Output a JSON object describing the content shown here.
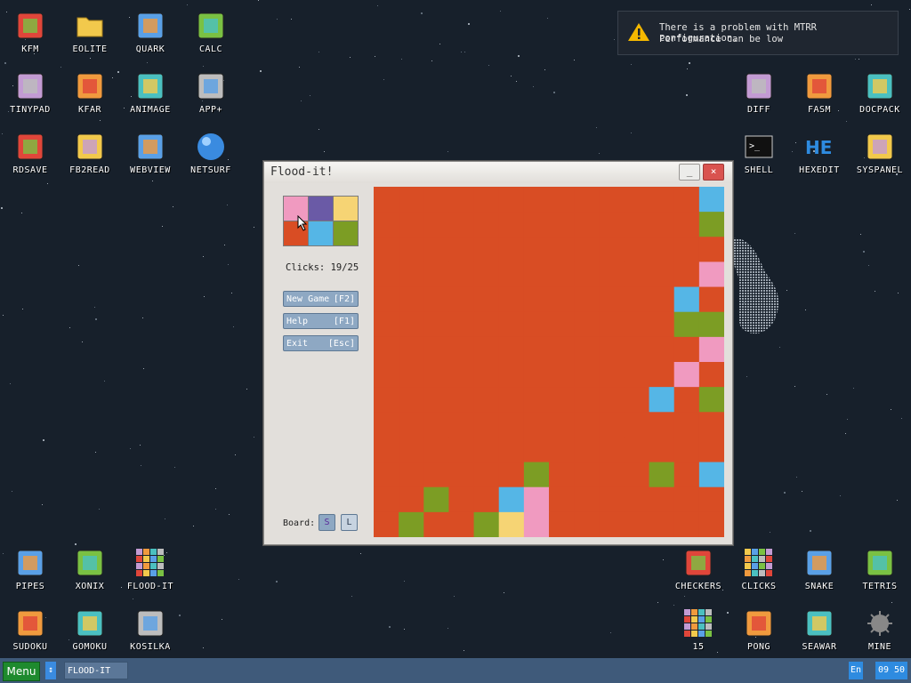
{
  "desktop_icons": [
    {
      "label": "KFM",
      "icon": "floppy-disk-icon"
    },
    {
      "label": "EOLITE",
      "icon": "folder-icon"
    },
    {
      "label": "QUARK",
      "icon": "book-icon"
    },
    {
      "label": "CALC",
      "icon": "calculator-icon"
    },
    {
      "label": "TINYPAD",
      "icon": "notepad-icon"
    },
    {
      "label": "KFAR",
      "icon": "file-manager-icon"
    },
    {
      "label": "ANIMAGE",
      "icon": "pencil-ruler-icon"
    },
    {
      "label": "APP+",
      "icon": "cube-icon"
    },
    {
      "label": "RDSAVE",
      "icon": "ram-disk-icon"
    },
    {
      "label": "FB2READ",
      "icon": "fb2-book-icon"
    },
    {
      "label": "WEBVIEW",
      "icon": "web-image-icon"
    },
    {
      "label": "NETSURF",
      "icon": "globe-icon"
    },
    {
      "label": "DIFF",
      "icon": "diff-icon"
    },
    {
      "label": "FASM",
      "icon": "fasm-icon"
    },
    {
      "label": "DOCPACK",
      "icon": "drawer-icon"
    },
    {
      "label": "SHELL",
      "icon": "terminal-icon"
    },
    {
      "label": "HEXEDIT",
      "icon": "hex-icon"
    },
    {
      "label": "SYSPANEL",
      "icon": "sliders-icon"
    },
    {
      "label": "PIPES",
      "icon": "pipes-icon"
    },
    {
      "label": "XONIX",
      "icon": "xonix-icon"
    },
    {
      "label": "FLOOD-IT",
      "icon": "color-grid-icon"
    },
    {
      "label": "SUDOKU",
      "icon": "sudoku-icon"
    },
    {
      "label": "GOMOKU",
      "icon": "tic-tac-toe-icon"
    },
    {
      "label": "KOSILKA",
      "icon": "lawnmower-icon"
    },
    {
      "label": "CHECKERS",
      "icon": "checkers-icon"
    },
    {
      "label": "CLICKS",
      "icon": "blocks-icon"
    },
    {
      "label": "SNAKE",
      "icon": "snake-icon"
    },
    {
      "label": "TETRIS",
      "icon": "tetris-icon"
    },
    {
      "label": "15",
      "icon": "fifteen-puzzle-icon"
    },
    {
      "label": "PONG",
      "icon": "pong-icon"
    },
    {
      "label": "SEAWAR",
      "icon": "ship-icon"
    },
    {
      "label": "MINE",
      "icon": "mine-icon"
    }
  ],
  "notification": {
    "line1": "There is a problem with MTRR configuration.",
    "line2": "Performance can be low",
    "icon": "warning-icon",
    "color": "#f5b800"
  },
  "window": {
    "title": "Flood-it!",
    "minimize_label": "_",
    "close_label": "×",
    "palette": [
      "#f09ac0",
      "#6a5aa6",
      "#f6d474",
      "#d94d24",
      "#55b6e6",
      "#7c9d24"
    ],
    "clicks_label": "Clicks: 19/25",
    "buttons": [
      {
        "label": "New Game",
        "key": "[F2]"
      },
      {
        "label": "Help",
        "key": "[F1]"
      },
      {
        "label": "Exit",
        "key": "[Esc]"
      }
    ],
    "board_label": "Board:",
    "size_small": "S",
    "size_large": "L"
  },
  "board": {
    "size": 14,
    "fill_color": "#d94d24",
    "colors": {
      "P": "#f09ac0",
      "V": "#6a5aa6",
      "Y": "#f6d474",
      "R": "#d94d24",
      "B": "#55b6e6",
      "G": "#7c9d24"
    },
    "rows": [
      "RRRRRRRRRRRRRB",
      "RRRRRRRRRRRRRG",
      "RRRRRRRRRRRRRR",
      "RRRRRRRRRRRRRP",
      "RRRRRRRRRRRRBR",
      "RRRRRRRRRRRRGG",
      "RRRRRRRRRRRRRP",
      "RRRRRRRRRRRRPR",
      "RRRRRRRRRRRBRG",
      "RRRRRRRRRRRRRR",
      "RRRRRRRRRRRRRR",
      "RRRRRRGRRRRGRB",
      "RRGRRBPRRRRRRR",
      "RGRRGYPRRRRRRR"
    ]
  },
  "taskbar": {
    "menu_label": "Menu",
    "swap_label": "↕",
    "active_app": "FLOOD-IT",
    "language": "En",
    "time": "09 50"
  }
}
